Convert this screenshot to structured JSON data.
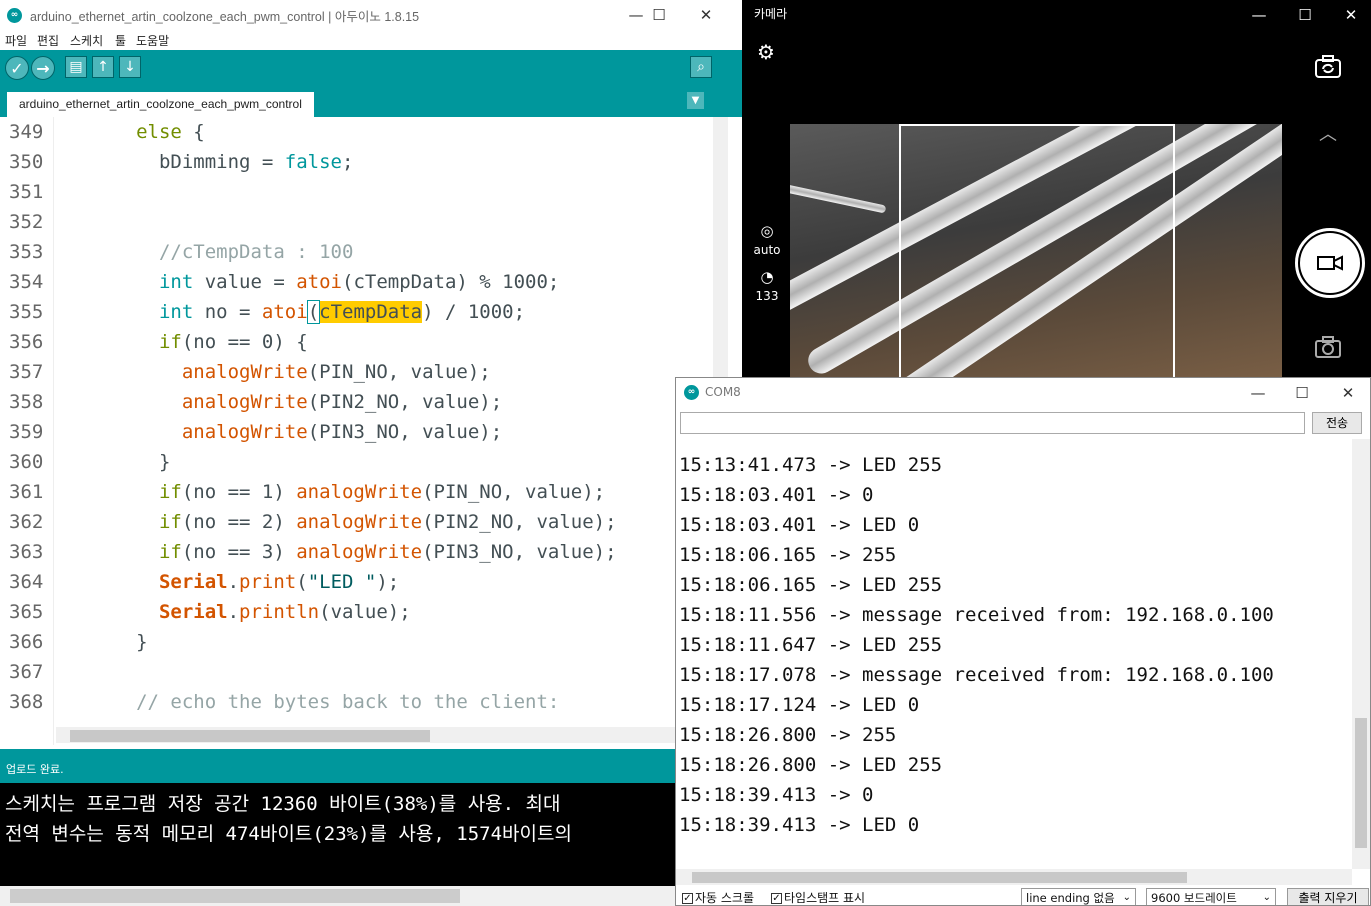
{
  "ide": {
    "title": "arduino_ethernet_artin_coolzone_each_pwm_control | 아두이노 1.8.15",
    "menu": [
      "파일",
      "편집",
      "스케치",
      "툴",
      "도움말"
    ],
    "tab_label": "arduino_ethernet_artin_coolzone_each_pwm_control",
    "line_numbers": [
      "349",
      "350",
      "351",
      "352",
      "353",
      "354",
      "355",
      "356",
      "357",
      "358",
      "359",
      "360",
      "361",
      "362",
      "363",
      "364",
      "365",
      "366",
      "367",
      "368"
    ],
    "code": {
      "l349_kw": "else",
      "l349_rest": " {",
      "l350_var": "bDimming = ",
      "l350_val": "false",
      "l350_end": ";",
      "l353": "//cTempData : 100",
      "l354_type": "int",
      "l354_a": " value = ",
      "l354_fn": "atoi",
      "l354_b": "(cTempData) % 1000;",
      "l355_type": "int",
      "l355_a": " no = ",
      "l355_fn": "atoi",
      "l355_paren": "(",
      "l355_sel": "cTempData",
      "l355_b": ") / 1000;",
      "l356_kw": "if",
      "l356_rest": "(no == 0) {",
      "l357_fn": "analogWrite",
      "l357_rest": "(PIN_NO, value);",
      "l358_fn": "analogWrite",
      "l358_rest": "(PIN2_NO, value);",
      "l359_fn": "analogWrite",
      "l359_rest": "(PIN3_NO, value);",
      "l360": "}",
      "l361_kw": "if",
      "l361_a": "(no == 1) ",
      "l361_fn": "analogWrite",
      "l361_b": "(PIN_NO, value);",
      "l362_kw": "if",
      "l362_a": "(no == 2) ",
      "l362_fn": "analogWrite",
      "l362_b": "(PIN2_NO, value);",
      "l363_kw": "if",
      "l363_a": "(no == 3) ",
      "l363_fn": "analogWrite",
      "l363_b": "(PIN3_NO, value);",
      "l364_cls": "Serial",
      "l364_dot": ".",
      "l364_fn": "print",
      "l364_p": "(",
      "l364_str": "\"LED \"",
      "l364_end": ");",
      "l365_cls": "Serial",
      "l365_dot": ".",
      "l365_fn": "println",
      "l365_rest": "(value);",
      "l366": "}",
      "l368": "// echo the bytes back to the client:"
    },
    "status": "업로드 완료.",
    "console": [
      "스케치는 프로그램 저장 공간 12360 바이트(38%)를 사용. 최대",
      "전역 변수는 동적 메모리 474바이트(23%)를 사용, 1574바이트의"
    ]
  },
  "camera": {
    "title": "카메라",
    "auto_label": "auto",
    "iso_value": "133"
  },
  "serial": {
    "title": "COM8",
    "send_label": "전송",
    "lines": [
      "15:13:41.473 -> LED 255",
      "15:18:03.401 -> 0",
      "15:18:03.401 -> LED 0",
      "15:18:06.165 -> 255",
      "15:18:06.165 -> LED 255",
      "15:18:11.556 -> message received from: 192.168.0.100",
      "15:18:11.647 -> LED 255",
      "15:18:17.078 -> message received from: 192.168.0.100",
      "15:18:17.124 -> LED 0",
      "15:18:26.800 -> 255",
      "15:18:26.800 -> LED 255",
      "15:18:39.413 -> 0",
      "15:18:39.413 -> LED 0"
    ],
    "autoscroll_label": "자동 스크롤",
    "timestamp_label": "타임스탬프 표시",
    "line_ending": "line ending 없음",
    "baud": "9600 보드레이트",
    "clear_label": "출력 지우기"
  },
  "colors": {
    "arduino_teal": "#00979c",
    "keyword_green": "#728e00",
    "function_orange": "#d35400",
    "selection_yellow": "#ffcc00"
  }
}
